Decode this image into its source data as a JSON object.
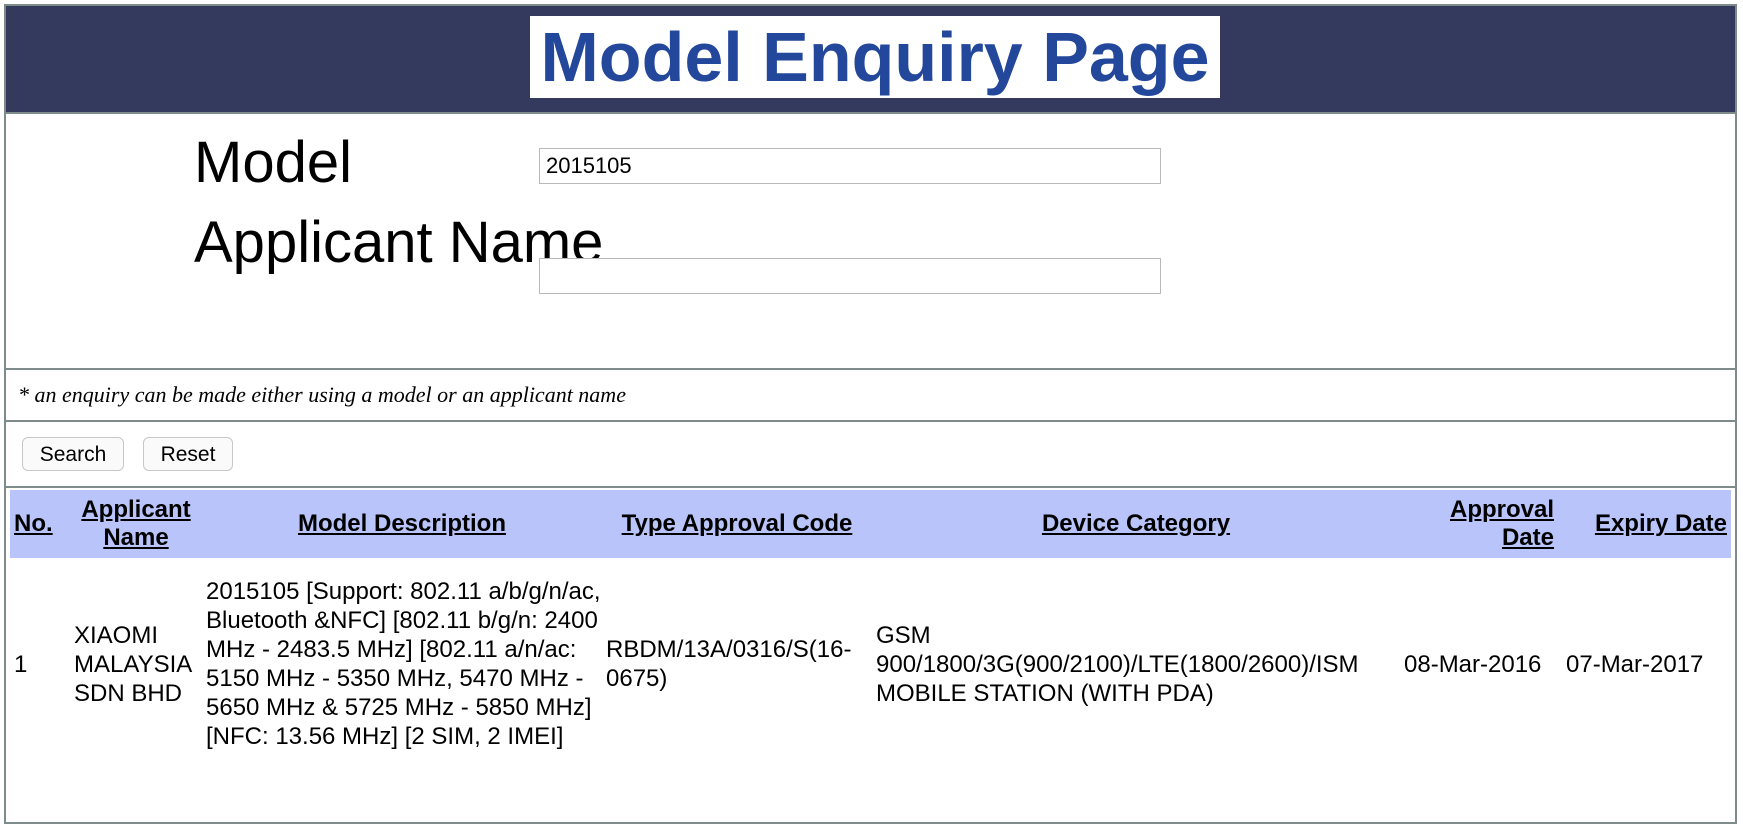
{
  "header": {
    "title": "Model Enquiry Page"
  },
  "form": {
    "model_label": "Model",
    "model_value": "2015105",
    "applicant_label": "Applicant Name",
    "applicant_value": "",
    "note": "* an enquiry can be made either using a model or an applicant name"
  },
  "buttons": {
    "search_label": "Search",
    "reset_label": "Reset"
  },
  "results": {
    "header_bg_color": "#b8c4fa",
    "columns": [
      "No.",
      "Applicant Name",
      "Model Description",
      "Type Approval Code",
      "Device Category",
      "Approval Date",
      "Expiry Date"
    ],
    "rows": [
      {
        "no": "1",
        "applicant_name": "XIAOMI MALAYSIA SDN BHD",
        "model_description": "2015105 [Support: 802.11 a/b/g/n/ac, Bluetooth &NFC] [802.11 b/g/n: 2400 MHz - 2483.5 MHz] [802.11 a/n/ac: 5150 MHz - 5350 MHz, 5470 MHz - 5650 MHz & 5725 MHz - 5850 MHz] [NFC: 13.56 MHz] [2 SIM, 2 IMEI]",
        "type_approval_code": "RBDM/13A/0316/S(16-0675)",
        "device_category": "GSM 900/1800/3G(900/2100)/LTE(1800/2600)/ISM MOBILE STATION (WITH PDA)",
        "approval_date": "08-Mar-2016",
        "expiry_date": "07-Mar-2017"
      }
    ]
  }
}
